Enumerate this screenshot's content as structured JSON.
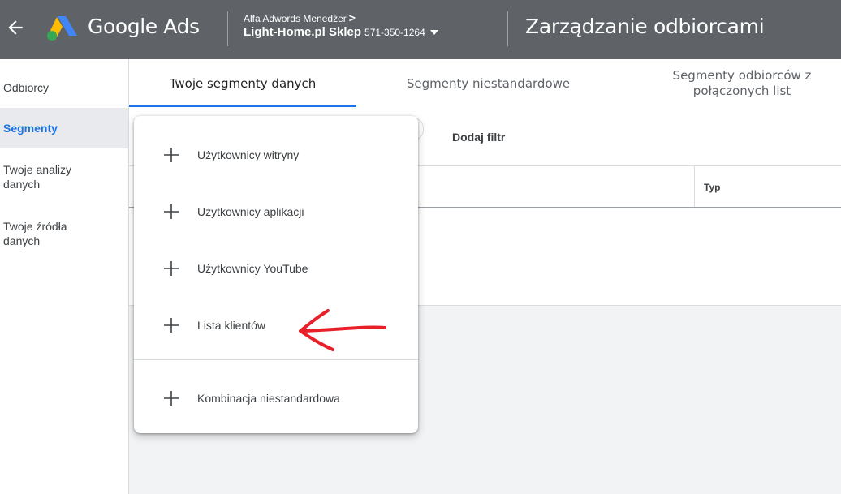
{
  "header": {
    "product_name": "Google Ads",
    "account_manager": "Alfa Adwords Menedżer",
    "account_name": "Light-Home.pl Sklep",
    "account_id": "571-350-1264",
    "page_title": "Zarządzanie odbiorcami"
  },
  "sidebar": {
    "items": [
      {
        "label": "Odbiorcy"
      },
      {
        "label": "Segmenty"
      },
      {
        "label": "Twoje analizy danych"
      },
      {
        "label": "Twoje źródła danych"
      }
    ]
  },
  "tabs": [
    {
      "label": "Twoje segmenty danych"
    },
    {
      "label": "Segmenty niestandardowe"
    },
    {
      "label": "Segmenty odbiorców z połączonych list"
    }
  ],
  "toolbar": {
    "add_filter": "Dodaj filtr"
  },
  "table": {
    "columns": {
      "type": "Typ"
    }
  },
  "dropdown": {
    "items": [
      {
        "label": "Użytkownicy witryny"
      },
      {
        "label": "Użytkownicy aplikacji"
      },
      {
        "label": "Użytkownicy YouTube"
      },
      {
        "label": "Lista klientów"
      },
      {
        "label": "Kombinacja niestandardowa"
      }
    ]
  },
  "colors": {
    "header_bg": "#5f6368",
    "accent": "#1a73e8",
    "annotation": "#e8202a"
  },
  "icons": [
    "back-arrow-icon",
    "google-ads-logo-icon",
    "chevron-right-icon",
    "dropdown-caret-icon",
    "plus-icon"
  ]
}
